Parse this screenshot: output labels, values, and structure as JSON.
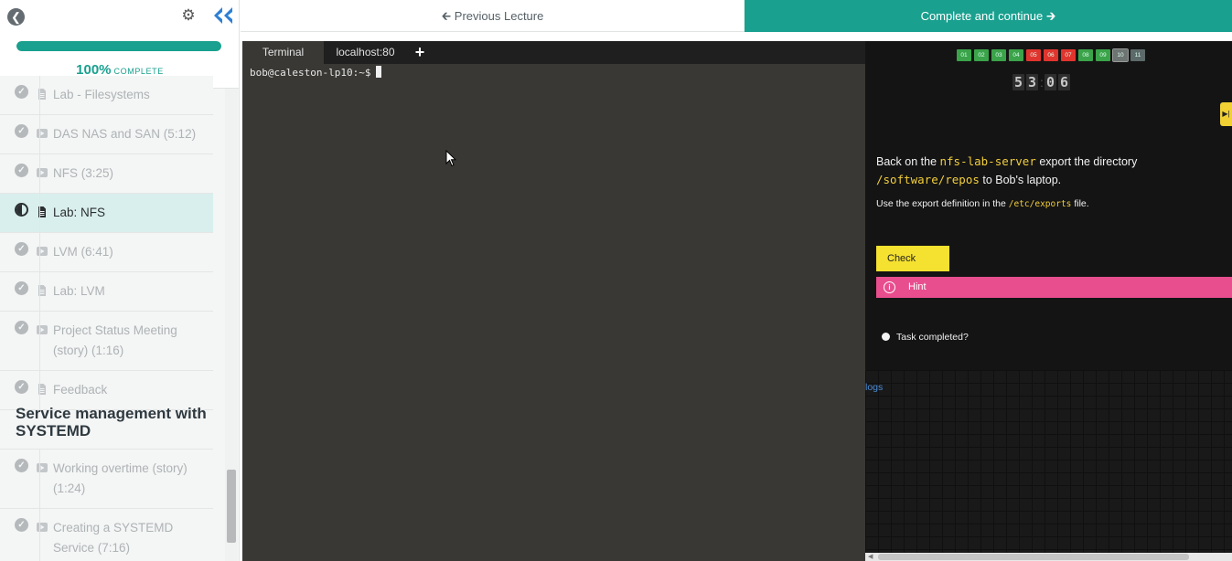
{
  "sidebar": {
    "progress": {
      "value": 100,
      "percent_label": "100%",
      "complete_word": "COMPLETE"
    },
    "lectures": [
      {
        "label": "Lab - Filesystems",
        "type": "doc",
        "state": "done"
      },
      {
        "label": "DAS NAS and SAN (5:12)",
        "type": "video",
        "state": "done"
      },
      {
        "label": "NFS (3:25)",
        "type": "video",
        "state": "done"
      },
      {
        "label": "Lab: NFS",
        "type": "doc",
        "state": "current"
      },
      {
        "label": "LVM (6:41)",
        "type": "video",
        "state": "done"
      },
      {
        "label": "Lab: LVM",
        "type": "doc",
        "state": "done"
      },
      {
        "label": "Project Status Meeting (story) (1:16)",
        "type": "video",
        "state": "done"
      },
      {
        "label": "Feedback",
        "type": "doc",
        "state": "done"
      }
    ],
    "section_title": "Service management with SYSTEMD",
    "section_lectures": [
      {
        "label": "Working overtime (story) (1:24)",
        "type": "video",
        "state": "done"
      },
      {
        "label": "Creating a SYSTEMD Service (7:16)",
        "type": "video",
        "state": "done"
      }
    ]
  },
  "nav": {
    "prev_label": "Previous Lecture",
    "next_label": "Complete and continue"
  },
  "terminal": {
    "tabs": [
      "Terminal",
      "localhost:80"
    ],
    "prompt": "bob@caleston-lp10:~$"
  },
  "lab": {
    "questions": [
      {
        "n": "01",
        "status": "correct"
      },
      {
        "n": "02",
        "status": "correct"
      },
      {
        "n": "03",
        "status": "correct"
      },
      {
        "n": "04",
        "status": "correct"
      },
      {
        "n": "05",
        "status": "wrong"
      },
      {
        "n": "06",
        "status": "wrong"
      },
      {
        "n": "07",
        "status": "wrong"
      },
      {
        "n": "08",
        "status": "correct"
      },
      {
        "n": "09",
        "status": "correct"
      },
      {
        "n": "10",
        "status": "current"
      },
      {
        "n": "11",
        "status": "pending"
      }
    ],
    "timer": {
      "minutes": "53",
      "seconds": "06"
    },
    "question": {
      "p1_a": "Back on the ",
      "p1_code1": "nfs-lab-server",
      "p1_b": " export the directory ",
      "p1_code2": "/software/repos",
      "p1_c": " to Bob's laptop.",
      "p2_a": "Use the export definition in the ",
      "p2_code": "/etc/exports",
      "p2_b": " file."
    },
    "check_label": "Check",
    "hint_label": "Hint",
    "task_label": "Task completed?",
    "logs_label": "logs"
  },
  "colors": {
    "accent": "#19a08f",
    "check": "#f5e12f",
    "hint": "#e84e8e"
  }
}
